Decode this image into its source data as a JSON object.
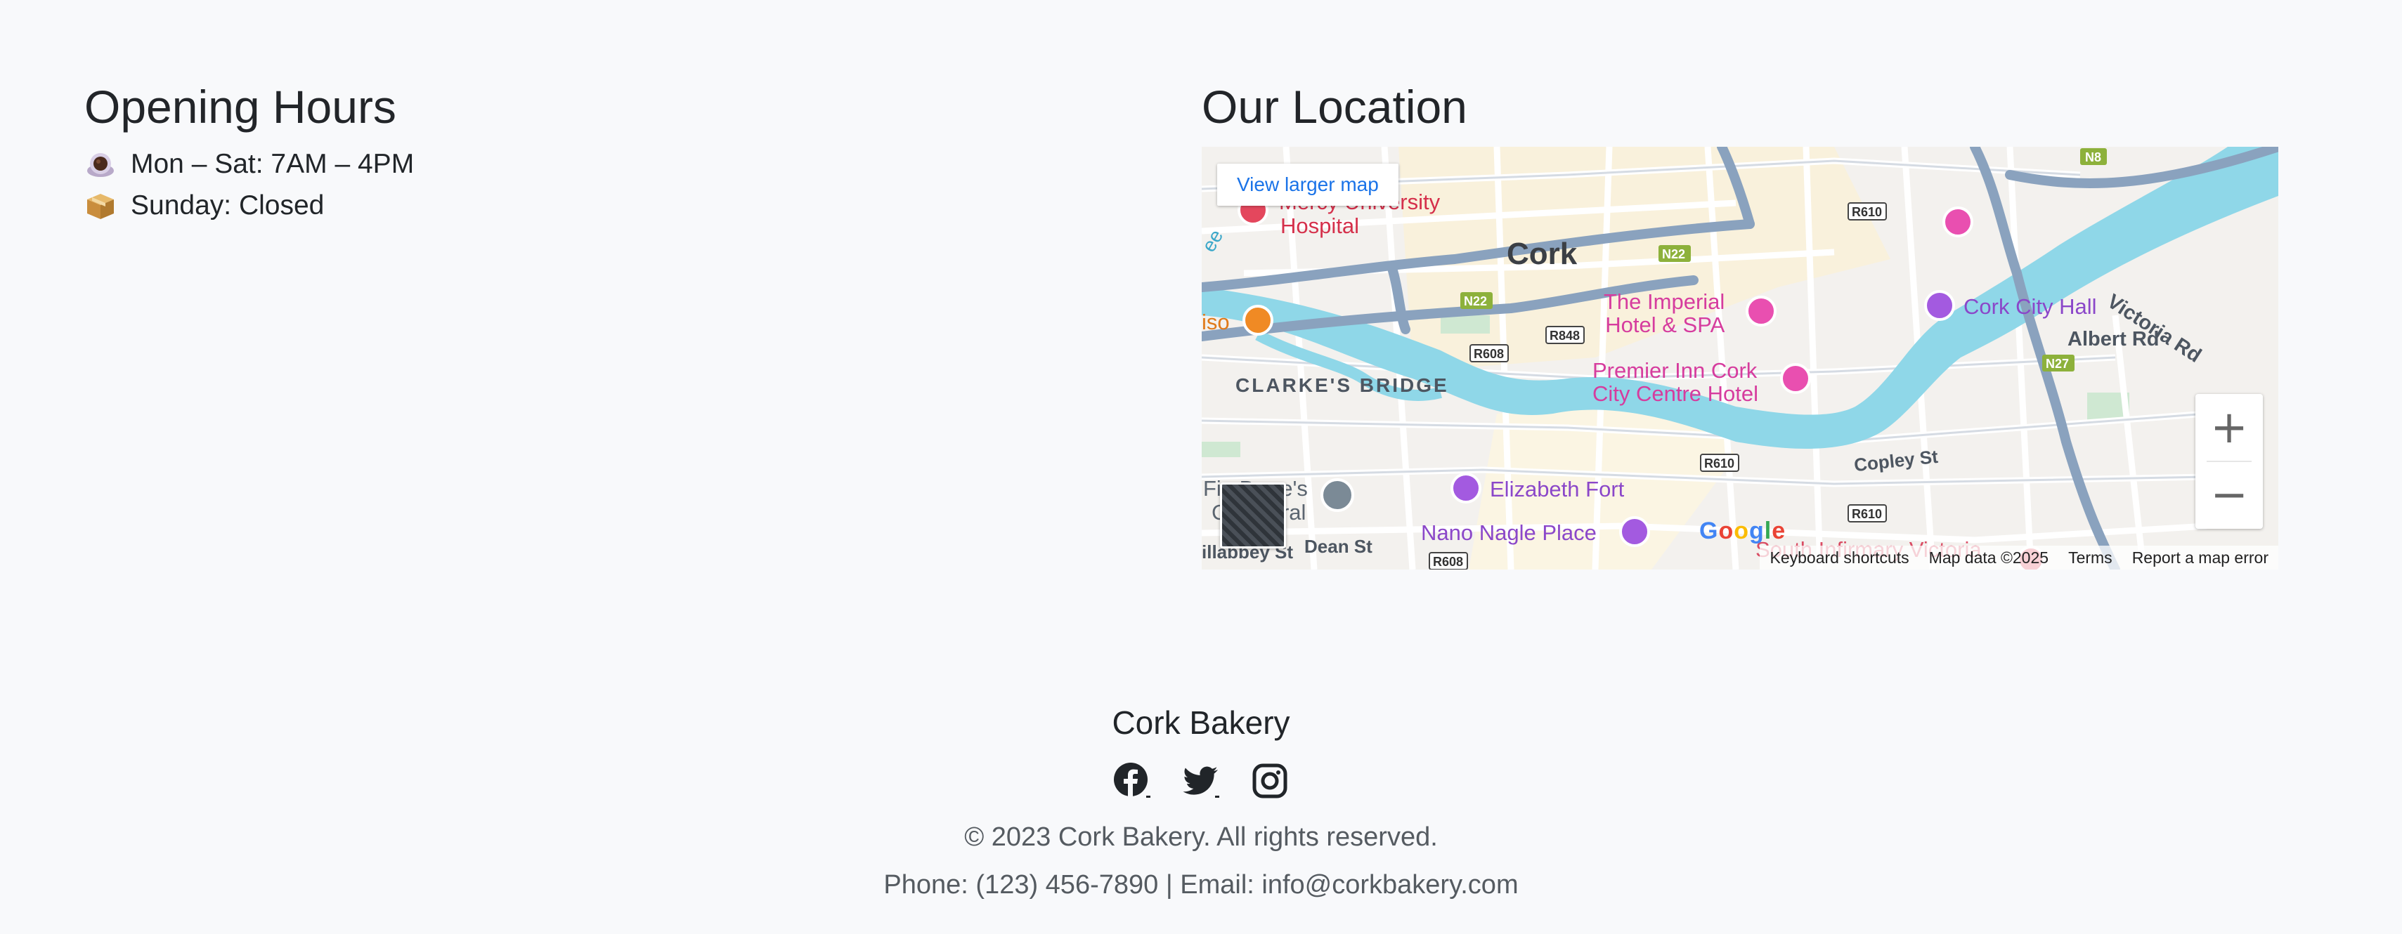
{
  "hours": {
    "title": "Opening Hours",
    "items": [
      {
        "icon": "coffee-icon",
        "text": "Mon – Sat: 7AM – 4PM"
      },
      {
        "icon": "box-icon",
        "text": "Sunday: Closed"
      }
    ]
  },
  "location": {
    "title": "Our Location",
    "map": {
      "view_larger": "View larger map",
      "labels": {
        "city": "Cork",
        "hospital_1": "Mercy University",
        "hospital_2": "Hospital",
        "imperial_1": "The Imperial",
        "imperial_2": "Hotel & SPA",
        "premier_1": "Premier Inn Cork",
        "premier_2": "City Centre Hotel",
        "city_hall": "Cork City Hall",
        "albert_rd": "Albert Rd",
        "victoria_rd": "Victoria Rd",
        "clarkes": "CLARKE'S BRIDGE",
        "elizabeth": "Elizabeth Fort",
        "nano": "Nano Nagle Place",
        "copley": "Copley St",
        "dean": "Dean St",
        "fin_1": "Fin Barre's",
        "fin_2": "Cathedral",
        "so": "iso",
        "ee": "ee",
        "illabbey": "illabbey St",
        "south_inf": "South Infirmary Victoria"
      },
      "roads": [
        "N8",
        "N22",
        "N22",
        "N27",
        "R610",
        "R608",
        "R848",
        "R610",
        "R610",
        "R608"
      ],
      "google": "Google",
      "footer": {
        "shortcuts": "Keyboard shortcuts",
        "data": "Map data ©2025",
        "terms": "Terms",
        "report": "Report a map error"
      },
      "zoom_in": "+",
      "zoom_out": "−"
    }
  },
  "footer": {
    "brand": "Cork Bakery",
    "social": [
      "facebook-icon",
      "twitter-icon",
      "instagram-icon"
    ],
    "copyright": "© 2023 Cork Bakery. All rights reserved.",
    "contact": "Phone: (123) 456-7890 | Email: info@corkbakery.com"
  },
  "colors": {
    "background": "#f8f9fb",
    "map_water": "#8fd7e8",
    "map_road": "#8aa2be",
    "map_link": "#1a73e8",
    "poi_pink": "#e94fb0",
    "poi_purple": "#a35ae0"
  }
}
